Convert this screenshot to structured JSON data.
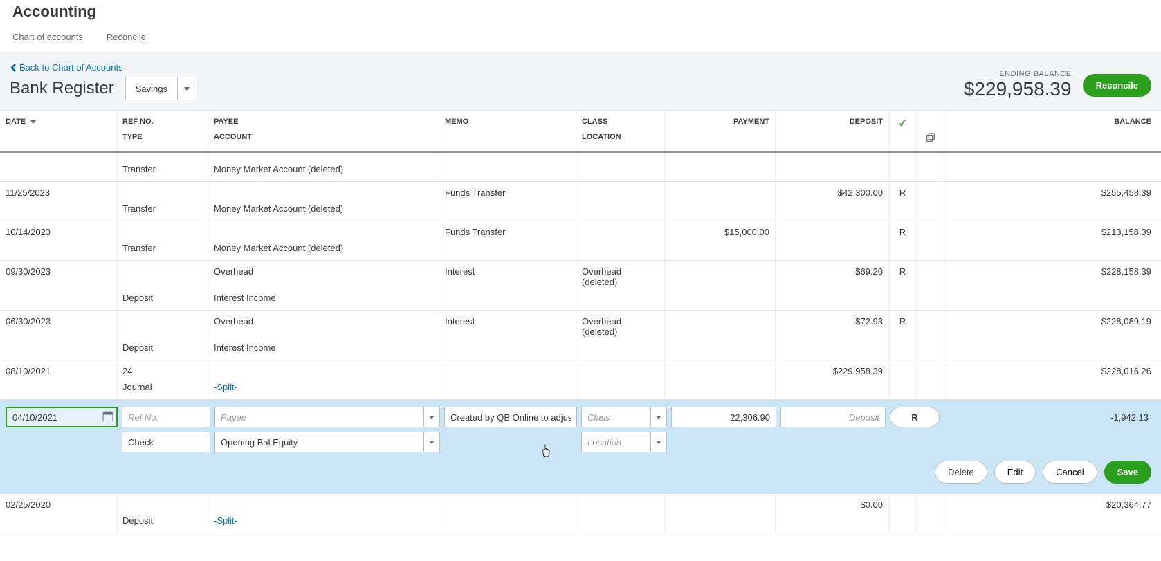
{
  "page_title": "Accounting",
  "tabs": {
    "chart": "Chart of accounts",
    "reconcile": "Reconcile"
  },
  "back_link": "Back to Chart of Accounts",
  "register_title": "Bank Register",
  "account_select": "Savings",
  "ending_balance_label": "ENDING BALANCE",
  "ending_balance_value": "$229,958.39",
  "reconcile_btn": "Reconcile",
  "headers": {
    "date": "DATE",
    "ref": "REF NO.",
    "type": "TYPE",
    "payee": "PAYEE",
    "account": "ACCOUNT",
    "memo": "MEMO",
    "class": "CLASS",
    "location": "LOCATION",
    "payment": "PAYMENT",
    "deposit": "DEPOSIT",
    "balance": "BALANCE"
  },
  "rows": [
    {
      "date": "",
      "ref": "",
      "type": "Transfer",
      "payee": "",
      "account": "Money Market Account (deleted)",
      "memo": "",
      "class": "",
      "location": "",
      "payment": "",
      "deposit": "",
      "chk": "",
      "balance": ""
    },
    {
      "date": "11/25/2023",
      "ref": "",
      "type": "Transfer",
      "payee": "",
      "account": "Money Market Account (deleted)",
      "memo": "Funds Transfer",
      "class": "",
      "location": "",
      "payment": "",
      "deposit": "$42,300.00",
      "chk": "R",
      "balance": "$255,458.39"
    },
    {
      "date": "10/14/2023",
      "ref": "",
      "type": "Transfer",
      "payee": "",
      "account": "Money Market Account (deleted)",
      "memo": "Funds Transfer",
      "class": "",
      "location": "",
      "payment": "$15,000.00",
      "deposit": "",
      "chk": "R",
      "balance": "$213,158.39"
    },
    {
      "date": "09/30/2023",
      "ref": "",
      "type": "Deposit",
      "payee": "Overhead",
      "account": "Interest Income",
      "memo": "Interest",
      "class": "Overhead (deleted)",
      "location": "",
      "payment": "",
      "deposit": "$69.20",
      "chk": "R",
      "balance": "$228,158.39"
    },
    {
      "date": "06/30/2023",
      "ref": "",
      "type": "Deposit",
      "payee": "Overhead",
      "account": "Interest Income",
      "memo": "Interest",
      "class": "Overhead (deleted)",
      "location": "",
      "payment": "",
      "deposit": "$72.93",
      "chk": "R",
      "balance": "$228,089.19"
    },
    {
      "date": "08/10/2021",
      "ref": "24",
      "type": "Journal",
      "payee": "",
      "account": "-Split-",
      "account_link": true,
      "memo": "",
      "class": "",
      "location": "",
      "payment": "",
      "deposit": "$229,958.39",
      "chk": "",
      "balance": "$228,016.26"
    }
  ],
  "edit": {
    "date": "04/10/2021",
    "ref_ph": "Ref No.",
    "payee_ph": "Payee",
    "memo": "Created by QB Online to adjust b",
    "class_ph": "Class",
    "payment": "22,306.90",
    "deposit_ph": "Deposit",
    "chk": "R",
    "balance": "-1,942.13",
    "type": "Check",
    "account": "Opening Bal Equity",
    "location_ph": "Location"
  },
  "actions": {
    "delete": "Delete",
    "edit": "Edit",
    "cancel": "Cancel",
    "save": "Save"
  },
  "tail_row": {
    "date": "02/25/2020",
    "ref": "",
    "type": "Deposit",
    "payee": "",
    "account": "-Split-",
    "account_link": true,
    "memo": "",
    "class": "",
    "location": "",
    "payment": "",
    "deposit": "$0.00",
    "chk": "",
    "balance": "$20,364.77"
  }
}
